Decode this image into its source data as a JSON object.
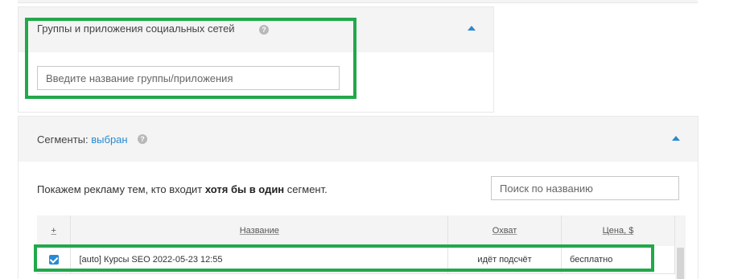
{
  "groups_panel": {
    "title": "Группы и приложения социальных сетей",
    "input_placeholder": "Введите название группы/приложения"
  },
  "segments_panel": {
    "title_prefix": "Сегменты:",
    "selected_link": "выбран",
    "description_before": "Покажем рекламу тем, кто входит ",
    "description_bold": "хотя бы в один",
    "description_after": " сегмент.",
    "search_placeholder": "Поиск по названию",
    "table": {
      "headers": {
        "check": "+",
        "name": "Название",
        "reach": "Охват",
        "price": "Цена, $"
      },
      "rows": [
        {
          "checked": true,
          "name": "[auto] Курсы SEO 2022-05-23 12:55",
          "reach": "идёт подсчёт",
          "price": "бесплатно"
        }
      ]
    }
  },
  "colors": {
    "accent": "#2a8ad1",
    "highlight": "#22a84a",
    "header_bg": "#f4f4f4"
  },
  "icons": [
    "help-icon",
    "collapse-arrow-icon",
    "checkbox-icon"
  ]
}
